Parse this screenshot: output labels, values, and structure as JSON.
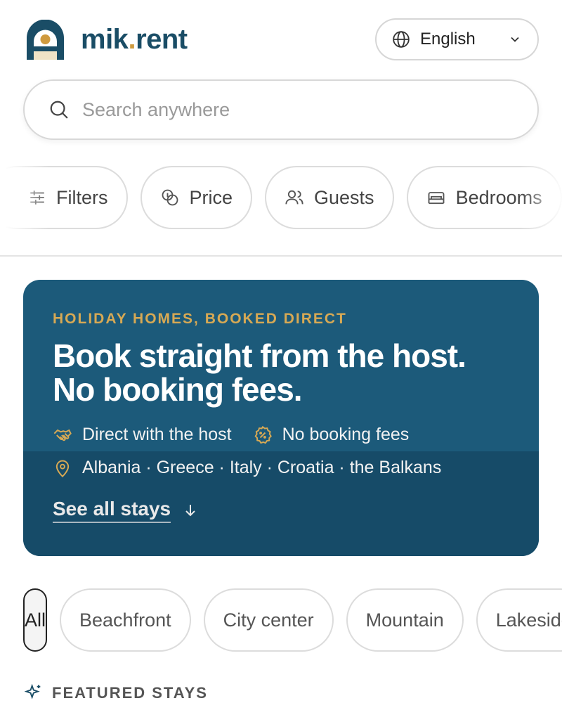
{
  "brand": {
    "name_main": "mik",
    "name_dot": ".",
    "name_suffix": "rent",
    "colors": {
      "primary": "#1a4d66",
      "accent": "#cf9a3e"
    }
  },
  "language": {
    "selected": "English",
    "icon": "globe-icon"
  },
  "search": {
    "placeholder": "Search anywhere",
    "value": ""
  },
  "filters": [
    {
      "label": "Filters",
      "icon": "sliders-icon"
    },
    {
      "label": "Price",
      "icon": "coins-icon"
    },
    {
      "label": "Guests",
      "icon": "users-icon"
    },
    {
      "label": "Bedrooms",
      "icon": "bed-icon"
    }
  ],
  "hero": {
    "eyebrow": "HOLIDAY HOMES, BOOKED DIRECT",
    "title_line1": "Book straight from the host.",
    "title_line2": "No booking fees.",
    "feature1": "Direct with the host",
    "feature2": "No booking fees",
    "locations": "Albania · Greece · Italy · Croatia · the Balkans",
    "cta": "See all stays",
    "colors": {
      "background": "#1c5a7a",
      "eyebrow": "#d7a954"
    }
  },
  "categories": [
    {
      "label": "All",
      "active": true
    },
    {
      "label": "Beachfront",
      "active": false
    },
    {
      "label": "City center",
      "active": false
    },
    {
      "label": "Mountain",
      "active": false
    },
    {
      "label": "Lakeside",
      "active": false
    }
  ],
  "featured": {
    "label": "FEATURED STAYS",
    "icon": "sparkle-icon"
  }
}
